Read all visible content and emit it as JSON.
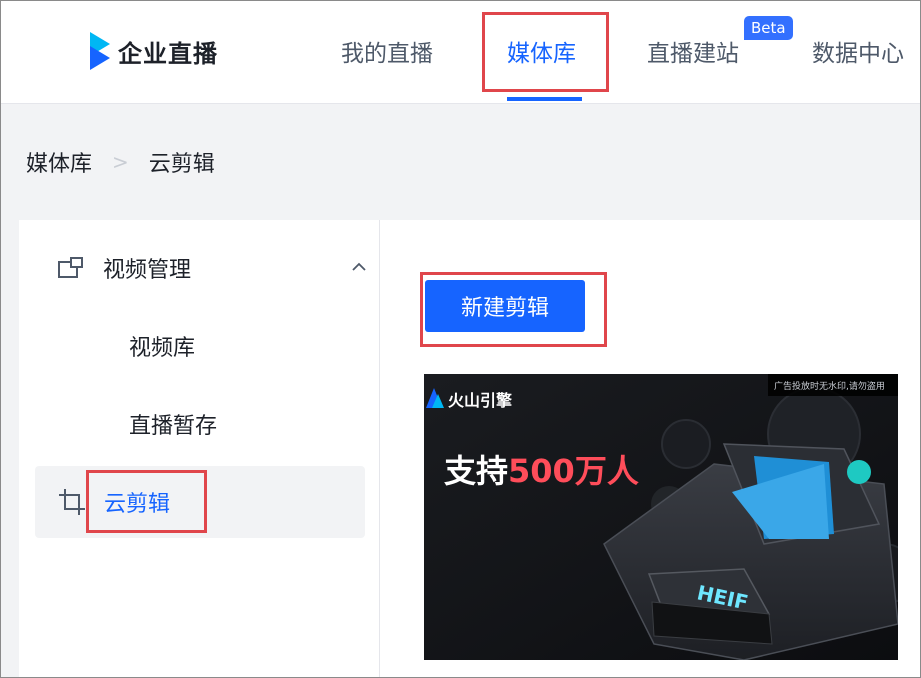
{
  "header": {
    "logo_text": "企业直播",
    "nav": [
      {
        "label": "我的直播",
        "active": false
      },
      {
        "label": "媒体库",
        "active": true
      },
      {
        "label": "直播建站",
        "active": false,
        "badge": "Beta"
      },
      {
        "label": "数据中心",
        "active": false
      }
    ]
  },
  "breadcrumb": {
    "items": [
      "媒体库",
      "云剪辑"
    ],
    "separator": ">"
  },
  "sidebar": {
    "group_label": "视频管理",
    "group_expanded": true,
    "sub_items": [
      {
        "label": "视频库"
      },
      {
        "label": "直播暂存"
      }
    ],
    "active_item": {
      "label": "云剪辑",
      "icon": "crop-icon"
    }
  },
  "main": {
    "new_clip_button": "新建剪辑",
    "banner": {
      "brand": "火山引擎",
      "notice": "广告投放时无水印,请勿盗用",
      "headline_prefix": "支持",
      "headline_highlight": "500万人",
      "chip_label": "HEIF"
    }
  },
  "colors": {
    "accent": "#1664ff",
    "highlight_box": "#e0464b",
    "banner_red": "#ff4d5a"
  }
}
